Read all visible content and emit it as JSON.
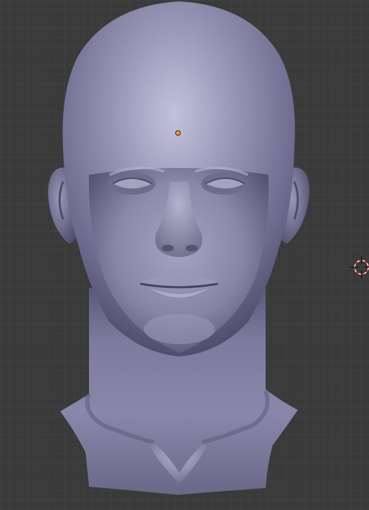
{
  "viewport": {
    "background_color": "#3a3a3a",
    "grid_minor_color": "#444444",
    "grid_major_color": "#4b4b4b",
    "axis_line_color": "#505050",
    "show_grid": true
  },
  "scene": {
    "object": "sculpted-head-mesh",
    "mesh_base_color": "#8c8aa8",
    "mesh_shadow_color": "#3b3a55",
    "mesh_highlight_color": "#c9c8e2",
    "origin_point_color": "#e89a3a",
    "cursor_colors": [
      "#ff2020",
      "#ffffff"
    ]
  }
}
